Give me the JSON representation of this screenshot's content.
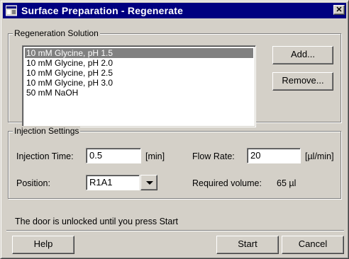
{
  "window": {
    "title": "Surface Preparation - Regenerate",
    "close_glyph": "✕"
  },
  "regeneration": {
    "legend": "Regeneration Solution",
    "items": [
      "10 mM Glycine, pH 1.5",
      "10 mM Glycine, pH 2.0",
      "10 mM Glycine, pH 2.5",
      "10 mM Glycine, pH 3.0",
      "50 mM NaOH"
    ],
    "selected": "10 mM Glycine, pH 1.5",
    "add_button": "Add...",
    "remove_button": "Remove..."
  },
  "injection": {
    "legend": "Injection Settings",
    "time_label": "Injection Time:",
    "time_value": "0.5",
    "time_unit": "[min]",
    "flow_label": "Flow Rate:",
    "flow_value": "20",
    "flow_unit": "[µl/min]",
    "position_label": "Position:",
    "position_value": "R1A1",
    "required_label": "Required volume:",
    "required_value": "65 µl"
  },
  "status": "The door is unlocked until you press Start",
  "buttons": {
    "help": "Help",
    "start": "Start",
    "cancel": "Cancel"
  },
  "icons": {
    "app": "app-window-icon",
    "close": "close-icon",
    "dropdown": "chevron-down-icon"
  },
  "colors": {
    "titlebar": "#000080",
    "face": "#d4d0c8",
    "selection": "#808080"
  }
}
